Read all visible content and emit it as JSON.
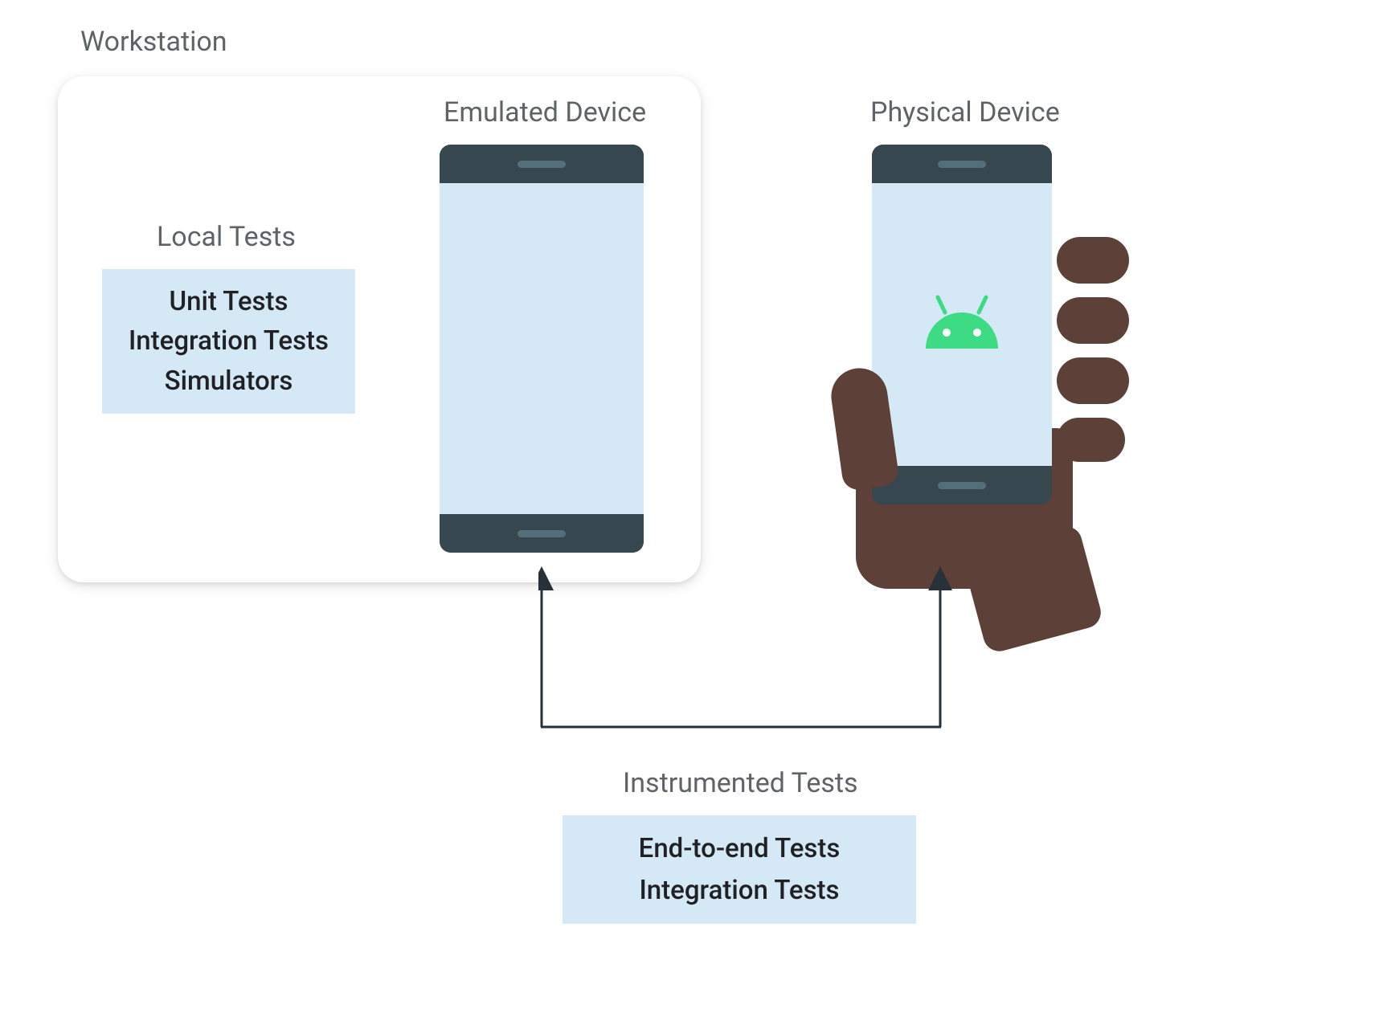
{
  "workstation": {
    "label": "Workstation"
  },
  "local_tests": {
    "label": "Local Tests",
    "items": [
      "Unit Tests",
      "Integration Tests",
      "Simulators"
    ]
  },
  "emulated_device": {
    "label": "Emulated Device"
  },
  "physical_device": {
    "label": "Physical Device"
  },
  "instrumented_tests": {
    "label": "Instrumented Tests",
    "items": [
      "End-to-end Tests",
      "Integration Tests"
    ]
  },
  "colors": {
    "light_blue": "#d5e8f5",
    "dark_gray": "#37474f",
    "text_gray": "#5f6368",
    "brown_hand": "#5d4037",
    "android_green": "#3ddc84",
    "arrow": "#263238"
  }
}
